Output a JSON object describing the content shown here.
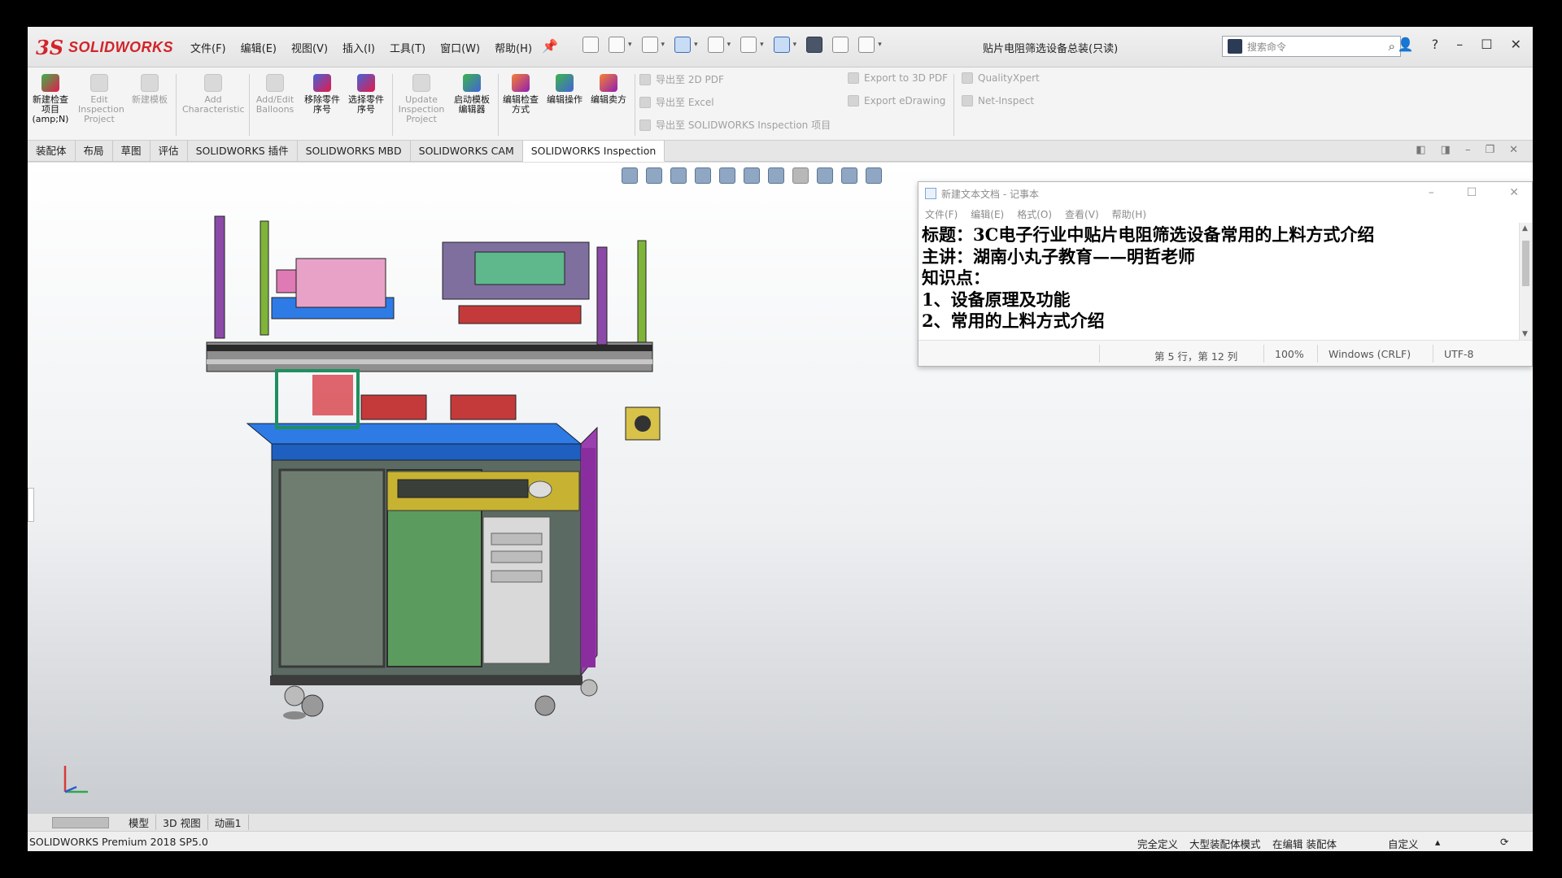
{
  "app": {
    "brand_prefix": "3S",
    "brand": "SOLIDWORKS",
    "document_title": "贴片电阻筛选设备总装(只读)",
    "search_placeholder": "搜索命令"
  },
  "menu": [
    "文件(F)",
    "编辑(E)",
    "视图(V)",
    "插入(I)",
    "工具(T)",
    "窗口(W)",
    "帮助(H)"
  ],
  "command_manager": {
    "buttons": [
      {
        "label": "新建检查项目(amp;N)",
        "enabled": true
      },
      {
        "label": "Edit Inspection Project",
        "enabled": false
      },
      {
        "label": "新建模板",
        "enabled": false
      },
      {
        "label": "Add Characteristic",
        "enabled": false
      },
      {
        "label": "Add/Edit Balloons",
        "enabled": false
      },
      {
        "label": "移除零件序号",
        "enabled": true
      },
      {
        "label": "选择零件序号",
        "enabled": true
      },
      {
        "label": "Update Inspection Project",
        "enabled": false
      },
      {
        "label": "启动模板编辑器",
        "enabled": true
      },
      {
        "label": "编辑检查方式",
        "enabled": true
      },
      {
        "label": "编辑操作",
        "enabled": true
      },
      {
        "label": "编辑卖方",
        "enabled": true
      }
    ],
    "export_col1": [
      "导出至 2D PDF",
      "导出至 Excel",
      "导出至 SOLIDWORKS Inspection 项目"
    ],
    "export_col2": [
      "Export to 3D PDF",
      "Export eDrawing"
    ],
    "export_col3": [
      "QualityXpert",
      "Net-Inspect"
    ]
  },
  "tabs": [
    "装配体",
    "布局",
    "草图",
    "评估",
    "SOLIDWORKS 插件",
    "SOLIDWORKS MBD",
    "SOLIDWORKS CAM",
    "SOLIDWORKS Inspection"
  ],
  "active_tab": "SOLIDWORKS Inspection",
  "notepad": {
    "title": "新建文本文档 - 记事本",
    "menu": [
      "文件(F)",
      "编辑(E)",
      "格式(O)",
      "查看(V)",
      "帮助(H)"
    ],
    "lines": [
      "标题：3C电子行业中贴片电阻筛选设备常用的上料方式介绍",
      "主讲：湖南小丸子教育——明哲老师",
      "知识点：",
      "1、设备原理及功能",
      "2、常用的上料方式介绍"
    ],
    "status": {
      "position": "第 5 行，第 12 列",
      "zoom": "100%",
      "eol": "Windows (CRLF)",
      "encoding": "UTF-8"
    }
  },
  "model_tabs": [
    "模型",
    "3D 视图",
    "动画1"
  ],
  "statusbar": {
    "left": "SOLIDWORKS Premium 2018 SP5.0",
    "right": [
      "完全定义",
      "大型装配体模式",
      "在编辑 装配体",
      "自定义"
    ]
  },
  "colors": {
    "brand_red": "#d2242a",
    "tab_active": "#ffffff"
  }
}
